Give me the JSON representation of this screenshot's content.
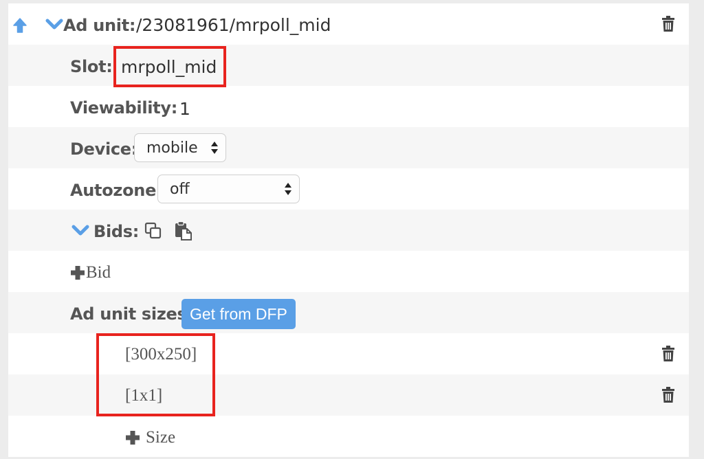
{
  "ad_unit": {
    "label": "Ad unit:",
    "value": "/23081961/mrpoll_mid"
  },
  "slot": {
    "label": "Slot:",
    "value": "mrpoll_mid"
  },
  "viewability": {
    "label": "Viewability:",
    "value": "1"
  },
  "device": {
    "label": "Device:",
    "selected": "mobile"
  },
  "autozone": {
    "label": "Autozone:",
    "selected": "off"
  },
  "bids": {
    "label": "Bids:",
    "add_label": "Bid"
  },
  "ad_unit_sizes": {
    "label": "Ad unit sizes:",
    "button_label": "Get from DFP",
    "sizes": [
      "[300x250]",
      "[1x1]"
    ],
    "add_label": "Size"
  },
  "colors": {
    "accent": "#5a9fe6",
    "highlight": "#e8231e"
  }
}
